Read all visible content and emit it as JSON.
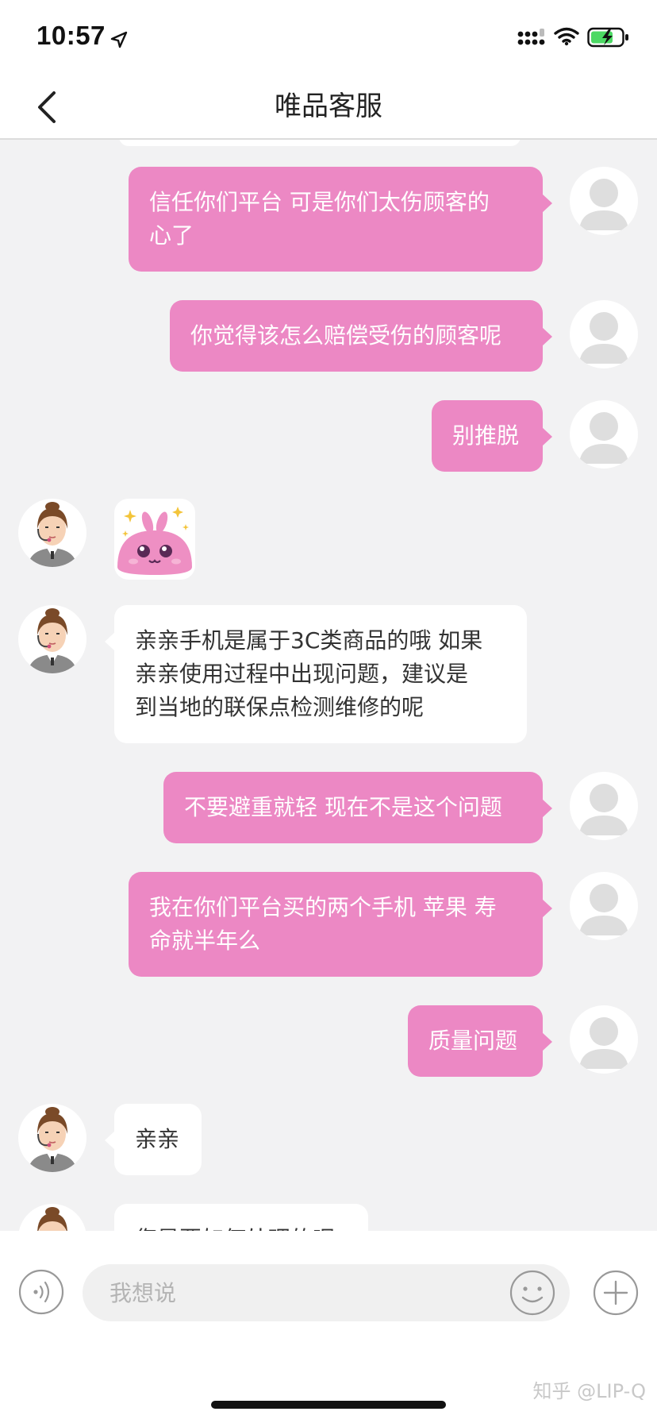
{
  "status_bar": {
    "time": "10:57",
    "icons": [
      "location-arrow-icon",
      "cellular-signal-icon",
      "wifi-icon",
      "battery-charging-icon"
    ],
    "battery_color": "#4cd964"
  },
  "nav": {
    "back_icon": "chevron-left-icon",
    "title": "唯品客服"
  },
  "colors": {
    "user_bubble": "#ec88c4",
    "agent_bubble": "#ffffff",
    "background": "#f2f2f3"
  },
  "messages": [
    {
      "sender": "user",
      "lines": [
        "信任你们平台 可是你们太伤顾客的",
        "心了"
      ]
    },
    {
      "sender": "user",
      "lines": [
        "你觉得该怎么赔偿受伤的顾客呢"
      ]
    },
    {
      "sender": "user",
      "lines": [
        "别推脱"
      ]
    },
    {
      "sender": "agent",
      "type": "sticker",
      "sticker": "pink-bunny-sparkle-sticker"
    },
    {
      "sender": "agent",
      "lines": [
        "亲亲手机是属于3C类商品的哦 如果",
        "亲亲使用过程中出现问题，建议是",
        "到当地的联保点检测维修的呢"
      ]
    },
    {
      "sender": "user",
      "lines": [
        "不要避重就轻 现在不是这个问题"
      ]
    },
    {
      "sender": "user",
      "lines": [
        "我在你们平台买的两个手机 苹果 寿",
        "命就半年么"
      ]
    },
    {
      "sender": "user",
      "lines": [
        "质量问题"
      ]
    },
    {
      "sender": "agent",
      "lines": [
        "亲亲"
      ]
    },
    {
      "sender": "agent",
      "lines": [
        "您是要如何处理的呢"
      ]
    }
  ],
  "input_bar": {
    "placeholder": "我想说",
    "voice_icon": "voice-input-icon",
    "emoji_icon": "smiley-face-icon",
    "add_icon": "plus-circle-icon"
  },
  "watermark": "知乎 @LIP-Q"
}
